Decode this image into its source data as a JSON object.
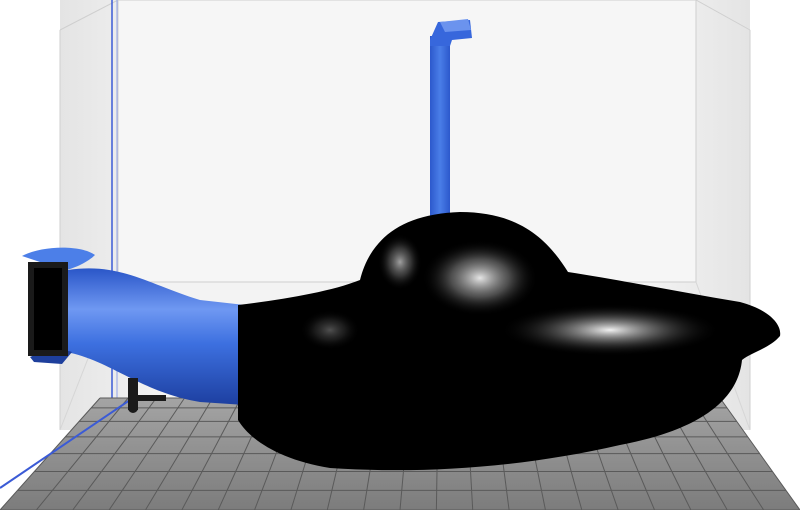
{
  "viewport": {
    "view": "3d-preview",
    "colors": {
      "background": "#ffffff",
      "volume_wall": "#ececec",
      "volume_edge": "#d6d6d6",
      "axis_line": "#3b5bd6",
      "bed": "#8a8a8a",
      "bed_grid": "#5a5a5a",
      "model_primary": "#000000",
      "model_accent": "#3b70e0"
    }
  },
  "scene": {
    "objects": [
      {
        "name": "submarine-hull",
        "color": "model_primary"
      },
      {
        "name": "periscope",
        "color": "model_accent"
      },
      {
        "name": "propeller-shroud",
        "color": "model_accent"
      }
    ]
  }
}
